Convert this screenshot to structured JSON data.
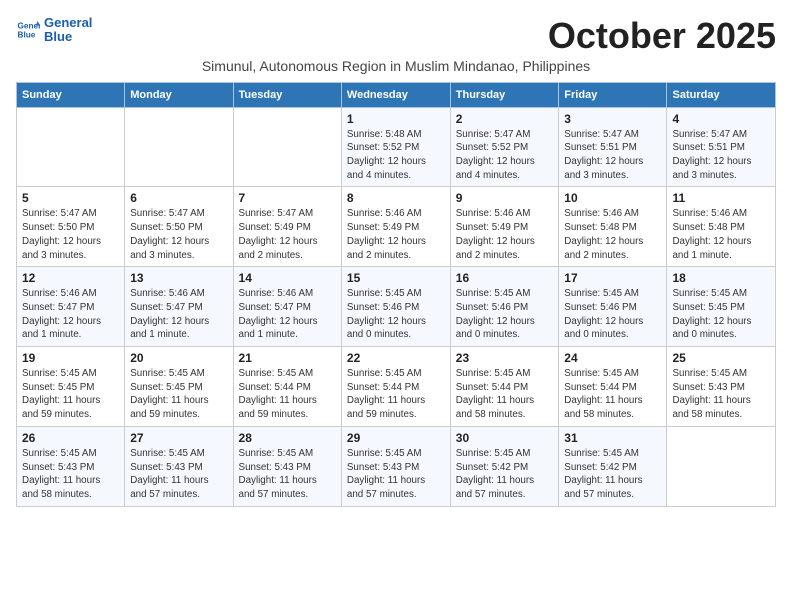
{
  "logo": {
    "line1": "General",
    "line2": "Blue"
  },
  "title": "October 2025",
  "subtitle": "Simunul, Autonomous Region in Muslim Mindanao, Philippines",
  "days_of_week": [
    "Sunday",
    "Monday",
    "Tuesday",
    "Wednesday",
    "Thursday",
    "Friday",
    "Saturday"
  ],
  "weeks": [
    [
      {
        "day": "",
        "info": ""
      },
      {
        "day": "",
        "info": ""
      },
      {
        "day": "",
        "info": ""
      },
      {
        "day": "1",
        "info": "Sunrise: 5:48 AM\nSunset: 5:52 PM\nDaylight: 12 hours\nand 4 minutes."
      },
      {
        "day": "2",
        "info": "Sunrise: 5:47 AM\nSunset: 5:52 PM\nDaylight: 12 hours\nand 4 minutes."
      },
      {
        "day": "3",
        "info": "Sunrise: 5:47 AM\nSunset: 5:51 PM\nDaylight: 12 hours\nand 3 minutes."
      },
      {
        "day": "4",
        "info": "Sunrise: 5:47 AM\nSunset: 5:51 PM\nDaylight: 12 hours\nand 3 minutes."
      }
    ],
    [
      {
        "day": "5",
        "info": "Sunrise: 5:47 AM\nSunset: 5:50 PM\nDaylight: 12 hours\nand 3 minutes."
      },
      {
        "day": "6",
        "info": "Sunrise: 5:47 AM\nSunset: 5:50 PM\nDaylight: 12 hours\nand 3 minutes."
      },
      {
        "day": "7",
        "info": "Sunrise: 5:47 AM\nSunset: 5:49 PM\nDaylight: 12 hours\nand 2 minutes."
      },
      {
        "day": "8",
        "info": "Sunrise: 5:46 AM\nSunset: 5:49 PM\nDaylight: 12 hours\nand 2 minutes."
      },
      {
        "day": "9",
        "info": "Sunrise: 5:46 AM\nSunset: 5:49 PM\nDaylight: 12 hours\nand 2 minutes."
      },
      {
        "day": "10",
        "info": "Sunrise: 5:46 AM\nSunset: 5:48 PM\nDaylight: 12 hours\nand 2 minutes."
      },
      {
        "day": "11",
        "info": "Sunrise: 5:46 AM\nSunset: 5:48 PM\nDaylight: 12 hours\nand 1 minute."
      }
    ],
    [
      {
        "day": "12",
        "info": "Sunrise: 5:46 AM\nSunset: 5:47 PM\nDaylight: 12 hours\nand 1 minute."
      },
      {
        "day": "13",
        "info": "Sunrise: 5:46 AM\nSunset: 5:47 PM\nDaylight: 12 hours\nand 1 minute."
      },
      {
        "day": "14",
        "info": "Sunrise: 5:46 AM\nSunset: 5:47 PM\nDaylight: 12 hours\nand 1 minute."
      },
      {
        "day": "15",
        "info": "Sunrise: 5:45 AM\nSunset: 5:46 PM\nDaylight: 12 hours\nand 0 minutes."
      },
      {
        "day": "16",
        "info": "Sunrise: 5:45 AM\nSunset: 5:46 PM\nDaylight: 12 hours\nand 0 minutes."
      },
      {
        "day": "17",
        "info": "Sunrise: 5:45 AM\nSunset: 5:46 PM\nDaylight: 12 hours\nand 0 minutes."
      },
      {
        "day": "18",
        "info": "Sunrise: 5:45 AM\nSunset: 5:45 PM\nDaylight: 12 hours\nand 0 minutes."
      }
    ],
    [
      {
        "day": "19",
        "info": "Sunrise: 5:45 AM\nSunset: 5:45 PM\nDaylight: 11 hours\nand 59 minutes."
      },
      {
        "day": "20",
        "info": "Sunrise: 5:45 AM\nSunset: 5:45 PM\nDaylight: 11 hours\nand 59 minutes."
      },
      {
        "day": "21",
        "info": "Sunrise: 5:45 AM\nSunset: 5:44 PM\nDaylight: 11 hours\nand 59 minutes."
      },
      {
        "day": "22",
        "info": "Sunrise: 5:45 AM\nSunset: 5:44 PM\nDaylight: 11 hours\nand 59 minutes."
      },
      {
        "day": "23",
        "info": "Sunrise: 5:45 AM\nSunset: 5:44 PM\nDaylight: 11 hours\nand 58 minutes."
      },
      {
        "day": "24",
        "info": "Sunrise: 5:45 AM\nSunset: 5:44 PM\nDaylight: 11 hours\nand 58 minutes."
      },
      {
        "day": "25",
        "info": "Sunrise: 5:45 AM\nSunset: 5:43 PM\nDaylight: 11 hours\nand 58 minutes."
      }
    ],
    [
      {
        "day": "26",
        "info": "Sunrise: 5:45 AM\nSunset: 5:43 PM\nDaylight: 11 hours\nand 58 minutes."
      },
      {
        "day": "27",
        "info": "Sunrise: 5:45 AM\nSunset: 5:43 PM\nDaylight: 11 hours\nand 57 minutes."
      },
      {
        "day": "28",
        "info": "Sunrise: 5:45 AM\nSunset: 5:43 PM\nDaylight: 11 hours\nand 57 minutes."
      },
      {
        "day": "29",
        "info": "Sunrise: 5:45 AM\nSunset: 5:43 PM\nDaylight: 11 hours\nand 57 minutes."
      },
      {
        "day": "30",
        "info": "Sunrise: 5:45 AM\nSunset: 5:42 PM\nDaylight: 11 hours\nand 57 minutes."
      },
      {
        "day": "31",
        "info": "Sunrise: 5:45 AM\nSunset: 5:42 PM\nDaylight: 11 hours\nand 57 minutes."
      },
      {
        "day": "",
        "info": ""
      }
    ]
  ]
}
